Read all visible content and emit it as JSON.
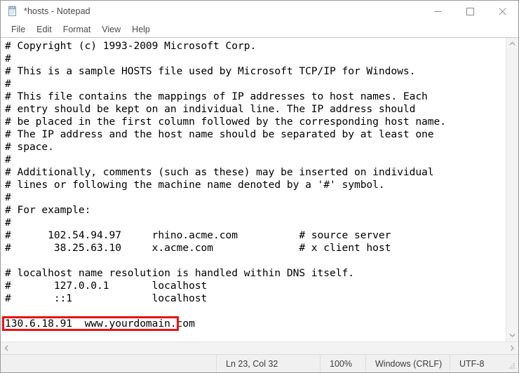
{
  "window": {
    "title": "*hosts - Notepad",
    "icon": "notepad-icon",
    "controls": {
      "minimize": "minimize-icon",
      "maximize": "maximize-icon",
      "close": "close-icon"
    }
  },
  "menubar": {
    "items": [
      {
        "label": "File"
      },
      {
        "label": "Edit"
      },
      {
        "label": "Format"
      },
      {
        "label": "View"
      },
      {
        "label": "Help"
      }
    ]
  },
  "editor": {
    "lines": [
      "# Copyright (c) 1993-2009 Microsoft Corp.",
      "#",
      "# This is a sample HOSTS file used by Microsoft TCP/IP for Windows.",
      "#",
      "# This file contains the mappings of IP addresses to host names. Each",
      "# entry should be kept on an individual line. The IP address should",
      "# be placed in the first column followed by the corresponding host name.",
      "# The IP address and the host name should be separated by at least one",
      "# space.",
      "#",
      "# Additionally, comments (such as these) may be inserted on individual",
      "# lines or following the machine name denoted by a '#' symbol.",
      "#",
      "# For example:",
      "#",
      "#      102.54.94.97     rhino.acme.com          # source server",
      "#       38.25.63.10     x.acme.com              # x client host",
      "",
      "# localhost name resolution is handled within DNS itself.",
      "#       127.0.0.1       localhost",
      "#       ::1             localhost",
      "",
      "130.6.18.91  www.yourdomain.com"
    ],
    "highlighted_line_index": 22,
    "highlight_color": "#ee1111"
  },
  "scrollbars": {
    "vertical": {
      "up": "chevron-up-icon",
      "down": "chevron-down-icon"
    },
    "horizontal": {
      "left": "chevron-left-icon",
      "right": "chevron-right-icon"
    }
  },
  "statusbar": {
    "cursor_position": "Ln 23, Col 32",
    "zoom": "100%",
    "line_ending": "Windows (CRLF)",
    "encoding": "UTF-8"
  }
}
